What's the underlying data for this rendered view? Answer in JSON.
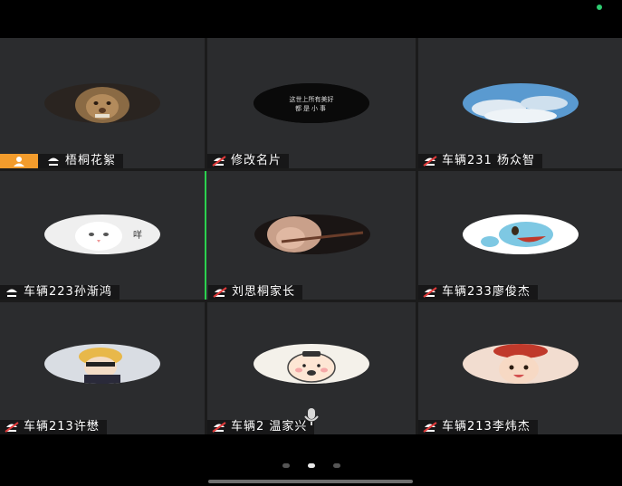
{
  "colors": {
    "tile_bg": "#2b2c2e",
    "active_border": "#2bd14e",
    "host_badge": "#f39c2c",
    "muted_icon": "#e23b3b"
  },
  "participants": [
    {
      "name": "梧桐花絮",
      "avatar": "lion-photo",
      "muted": false,
      "host": true
    },
    {
      "name": "修改名片",
      "avatar": "text-logo",
      "muted": true,
      "host": false,
      "avatar_text_top": "这世上所有美好",
      "avatar_text_bottom": "都是小事"
    },
    {
      "name": "车辆231  杨众智",
      "avatar": "sky-photo",
      "muted": true,
      "host": false
    },
    {
      "name": "车辆223孙渐鸿",
      "avatar": "cat-photo",
      "muted": false,
      "host": false,
      "avatar_text": "咩"
    },
    {
      "name": "刘思桐家长",
      "avatar": "violin-photo",
      "muted": true,
      "host": false
    },
    {
      "name": "车辆233廖俊杰",
      "avatar": "squirtle-cartoon",
      "muted": true,
      "host": false
    },
    {
      "name": "车辆213许懋",
      "avatar": "anime-boy",
      "muted": true,
      "host": false
    },
    {
      "name": "车辆2  温家兴",
      "avatar": "cartoon-face",
      "muted": true,
      "host": false
    },
    {
      "name": "车辆213李炜杰",
      "avatar": "child-photo",
      "muted": true,
      "host": false
    }
  ],
  "pager": {
    "pages": 3,
    "current": 2
  }
}
